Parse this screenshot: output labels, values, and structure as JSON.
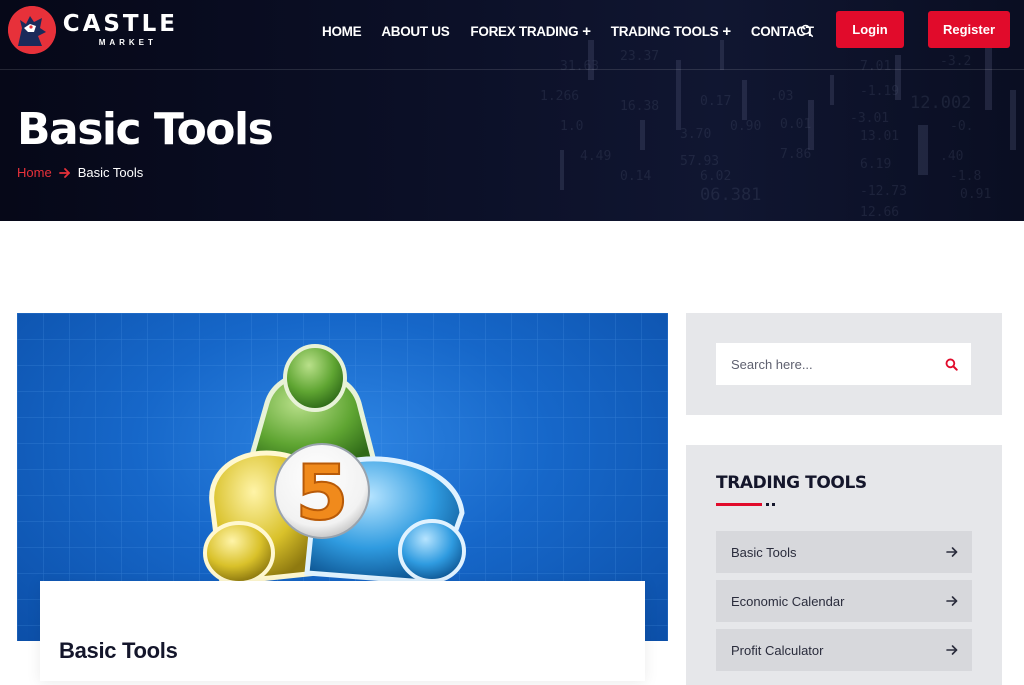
{
  "brand": {
    "name": "CASTLE",
    "tagline": "MARKET",
    "accent_color": "#e10b2b"
  },
  "nav": {
    "items": [
      {
        "label": "HOME",
        "has_submenu": false
      },
      {
        "label": "ABOUT US",
        "has_submenu": false
      },
      {
        "label": "FOREX TRADING",
        "has_submenu": true
      },
      {
        "label": "TRADING TOOLS",
        "has_submenu": true
      },
      {
        "label": "CONTACT",
        "has_submenu": false
      }
    ],
    "submenu_symbol": "+",
    "login_label": "Login",
    "register_label": "Register"
  },
  "hero": {
    "title": "Basic Tools",
    "breadcrumb": {
      "home": "Home",
      "current": "Basic Tools"
    }
  },
  "article": {
    "image_badge": "5",
    "card_title": "Basic Tools"
  },
  "sidebar": {
    "search": {
      "placeholder": "Search here..."
    },
    "tools_widget": {
      "title": "TRADING TOOLS",
      "items": [
        {
          "label": "Basic Tools"
        },
        {
          "label": "Economic Calendar"
        },
        {
          "label": "Profit Calculator"
        }
      ]
    }
  }
}
